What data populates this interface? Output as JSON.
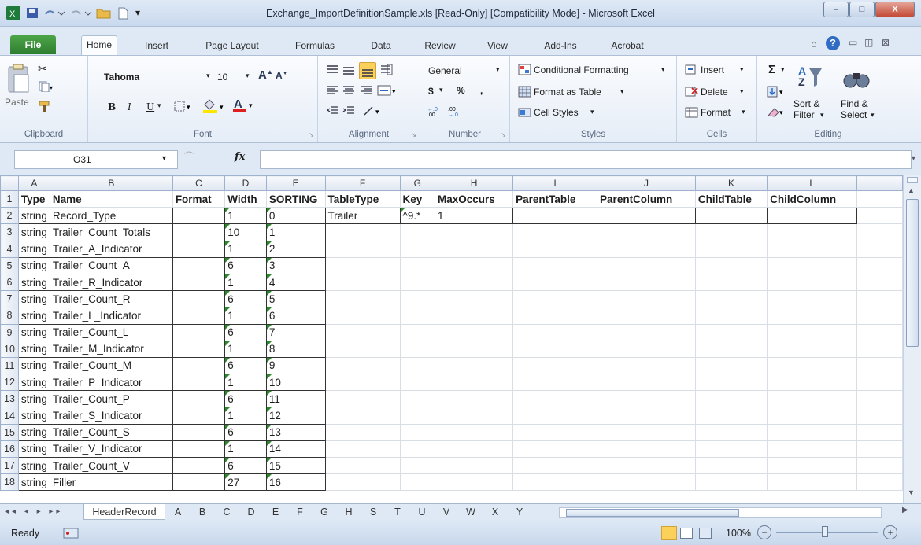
{
  "window": {
    "title": "Exchange_ImportDefinitionSample.xls [Read-Only] [Compatibility Mode] - Microsoft Excel",
    "minimize": "–",
    "maximize": "□",
    "close": "X"
  },
  "ribbon_tabs": [
    "File",
    "Home",
    "Insert",
    "Page Layout",
    "Formulas",
    "Data",
    "Review",
    "View",
    "Add-Ins",
    "Acrobat"
  ],
  "ribbon": {
    "clipboard": {
      "label": "Clipboard",
      "paste": "Paste"
    },
    "font": {
      "label": "Font",
      "name": "Tahoma",
      "size": "10",
      "bold": "B",
      "italic": "I",
      "underline": "U"
    },
    "alignment": {
      "label": "Alignment"
    },
    "number": {
      "label": "Number",
      "format": "General",
      "currency": "$",
      "percent": "%",
      "comma": ","
    },
    "styles": {
      "label": "Styles",
      "conditional": "Conditional Formatting",
      "table": "Format as Table",
      "cell": "Cell Styles"
    },
    "cells": {
      "label": "Cells",
      "insert": "Insert",
      "delete": "Delete",
      "format": "Format"
    },
    "editing": {
      "label": "Editing",
      "sum": "Σ",
      "sort": "Sort &",
      "sort2": "Filter",
      "find": "Find &",
      "find2": "Select"
    }
  },
  "formula_bar": {
    "name_box": "O31",
    "fx": "fx",
    "value": ""
  },
  "columns": [
    "A",
    "B",
    "C",
    "D",
    "E",
    "F",
    "G",
    "H",
    "I",
    "J",
    "K",
    "L"
  ],
  "header_row": [
    "Type",
    "Name",
    "Format",
    "Width",
    "SORTING",
    "TableType",
    "Key",
    "MaxOccurs",
    "ParentTable",
    "ParentColumn",
    "ChildTable",
    "ChildColumn"
  ],
  "row2": {
    "f": "Trailer",
    "g": "^9.*",
    "h": "1"
  },
  "rows": [
    {
      "n": "2",
      "type": "string",
      "name": "Record_Type",
      "width": "1",
      "sort": "0"
    },
    {
      "n": "3",
      "type": "string",
      "name": "Trailer_Count_Totals",
      "width": "10",
      "sort": "1"
    },
    {
      "n": "4",
      "type": "string",
      "name": "Trailer_A_Indicator",
      "width": "1",
      "sort": "2"
    },
    {
      "n": "5",
      "type": "string",
      "name": "Trailer_Count_A",
      "width": "6",
      "sort": "3"
    },
    {
      "n": "6",
      "type": "string",
      "name": "Trailer_R_Indicator",
      "width": "1",
      "sort": "4"
    },
    {
      "n": "7",
      "type": "string",
      "name": "Trailer_Count_R",
      "width": "6",
      "sort": "5"
    },
    {
      "n": "8",
      "type": "string",
      "name": "Trailer_L_Indicator",
      "width": "1",
      "sort": "6"
    },
    {
      "n": "9",
      "type": "string",
      "name": "Trailer_Count_L",
      "width": "6",
      "sort": "7"
    },
    {
      "n": "10",
      "type": "string",
      "name": "Trailer_M_Indicator",
      "width": "1",
      "sort": "8"
    },
    {
      "n": "11",
      "type": "string",
      "name": "Trailer_Count_M",
      "width": "6",
      "sort": "9"
    },
    {
      "n": "12",
      "type": "string",
      "name": "Trailer_P_Indicator",
      "width": "1",
      "sort": "10"
    },
    {
      "n": "13",
      "type": "string",
      "name": "Trailer_Count_P",
      "width": "6",
      "sort": "11"
    },
    {
      "n": "14",
      "type": "string",
      "name": "Trailer_S_Indicator",
      "width": "1",
      "sort": "12"
    },
    {
      "n": "15",
      "type": "string",
      "name": "Trailer_Count_S",
      "width": "6",
      "sort": "13"
    },
    {
      "n": "16",
      "type": "string",
      "name": "Trailer_V_Indicator",
      "width": "1",
      "sort": "14"
    },
    {
      "n": "17",
      "type": "string",
      "name": "Trailer_Count_V",
      "width": "6",
      "sort": "15"
    },
    {
      "n": "18",
      "type": "string",
      "name": "Filler",
      "width": "27",
      "sort": "16"
    }
  ],
  "sheet_tabs": [
    "HeaderRecord",
    "A",
    "B",
    "C",
    "D",
    "E",
    "F",
    "G",
    "H",
    "S",
    "T",
    "U",
    "V",
    "W",
    "X",
    "Y"
  ],
  "status": {
    "ready": "Ready",
    "zoom": "100%"
  },
  "colors": {
    "accent": "#2d7d2f",
    "ribbon": "#dfe9f5"
  }
}
